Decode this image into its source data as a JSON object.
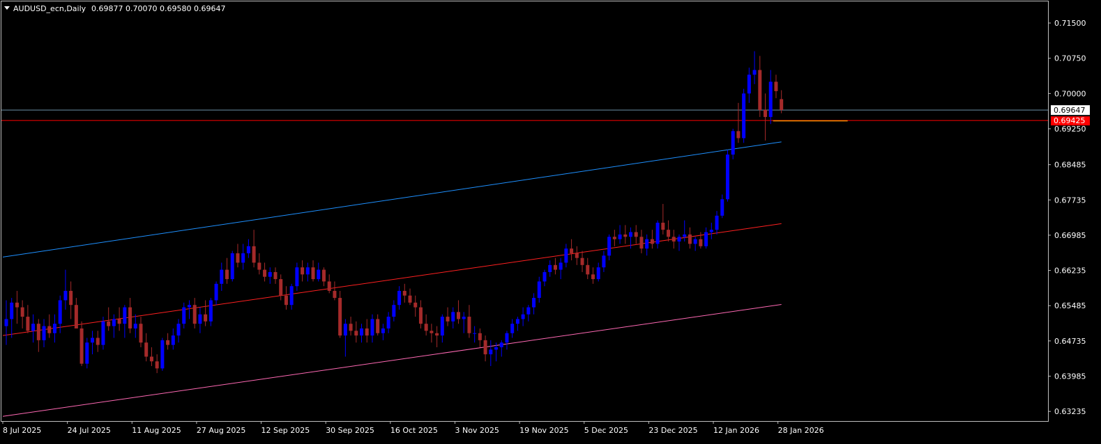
{
  "header": {
    "symbol_label": "AUDUSD_ecn,Daily",
    "ohlc": "0.69877 0.70070 0.69580 0.69647"
  },
  "colors": {
    "background": "#000000",
    "frame": "#c0c0c0",
    "bull": "#0000ff",
    "bear": "#a52a2a",
    "channel_upper": "#1e90ff",
    "channel_middle": "#ff2020",
    "channel_lower": "#ff69b4",
    "horizontal_level": "#ff0000",
    "bid_line": "#6b8fa8",
    "price_tag_bg": "#ff0000",
    "price_tag_text": "#ffffff",
    "bid_tag_bg": "#ffffff",
    "bid_tag_text": "#000000",
    "orange_segment": "#ff8c00"
  },
  "chart_data": {
    "type": "candlestick",
    "symbol": "AUDUSD_ecn",
    "timeframe": "Daily",
    "y_ticks": [
      "0.71500",
      "0.70750",
      "0.70000",
      "0.69250",
      "0.68485",
      "0.67735",
      "0.66985",
      "0.66235",
      "0.65485",
      "0.64735",
      "0.63985",
      "0.63235"
    ],
    "x_ticks": [
      "8 Jul 2025",
      "24 Jul 2025",
      "11 Aug 2025",
      "27 Aug 2025",
      "12 Sep 2025",
      "30 Sep 2025",
      "16 Oct 2025",
      "3 Nov 2025",
      "19 Nov 2025",
      "5 Dec 2025",
      "23 Dec 2025",
      "12 Jan 2026",
      "28 Jan 2026"
    ],
    "ylim": [
      0.6303,
      0.7196
    ],
    "current_bid": "0.69647",
    "horizontal_level": "0.69425",
    "channel": {
      "upper": {
        "start": 0.6652,
        "end": 0.6897
      },
      "middle": {
        "start": 0.6485,
        "end": 0.6723
      },
      "lower": {
        "start": 0.6313,
        "end": 0.6551
      }
    },
    "candles": [
      {
        "o": 0.6505,
        "h": 0.656,
        "l": 0.6465,
        "c": 0.652
      },
      {
        "o": 0.652,
        "h": 0.6565,
        "l": 0.648,
        "c": 0.6555
      },
      {
        "o": 0.6555,
        "h": 0.658,
        "l": 0.651,
        "c": 0.6545
      },
      {
        "o": 0.6545,
        "h": 0.656,
        "l": 0.65,
        "c": 0.6525
      },
      {
        "o": 0.6525,
        "h": 0.655,
        "l": 0.649,
        "c": 0.6495
      },
      {
        "o": 0.6495,
        "h": 0.653,
        "l": 0.647,
        "c": 0.651
      },
      {
        "o": 0.651,
        "h": 0.652,
        "l": 0.645,
        "c": 0.6475
      },
      {
        "o": 0.6475,
        "h": 0.652,
        "l": 0.646,
        "c": 0.6505
      },
      {
        "o": 0.6505,
        "h": 0.653,
        "l": 0.648,
        "c": 0.649
      },
      {
        "o": 0.649,
        "h": 0.653,
        "l": 0.647,
        "c": 0.651
      },
      {
        "o": 0.651,
        "h": 0.657,
        "l": 0.649,
        "c": 0.656
      },
      {
        "o": 0.656,
        "h": 0.6625,
        "l": 0.654,
        "c": 0.658
      },
      {
        "o": 0.658,
        "h": 0.66,
        "l": 0.652,
        "c": 0.655
      },
      {
        "o": 0.655,
        "h": 0.6565,
        "l": 0.65,
        "c": 0.65
      },
      {
        "o": 0.65,
        "h": 0.6515,
        "l": 0.642,
        "c": 0.6425
      },
      {
        "o": 0.6425,
        "h": 0.648,
        "l": 0.6415,
        "c": 0.647
      },
      {
        "o": 0.647,
        "h": 0.6495,
        "l": 0.6445,
        "c": 0.648
      },
      {
        "o": 0.648,
        "h": 0.6495,
        "l": 0.645,
        "c": 0.6465
      },
      {
        "o": 0.6465,
        "h": 0.6525,
        "l": 0.6455,
        "c": 0.6515
      },
      {
        "o": 0.6515,
        "h": 0.6545,
        "l": 0.6495,
        "c": 0.6505
      },
      {
        "o": 0.6505,
        "h": 0.653,
        "l": 0.648,
        "c": 0.652
      },
      {
        "o": 0.652,
        "h": 0.6545,
        "l": 0.6495,
        "c": 0.651
      },
      {
        "o": 0.651,
        "h": 0.655,
        "l": 0.648,
        "c": 0.6545
      },
      {
        "o": 0.6545,
        "h": 0.6565,
        "l": 0.649,
        "c": 0.65
      },
      {
        "o": 0.65,
        "h": 0.653,
        "l": 0.648,
        "c": 0.651
      },
      {
        "o": 0.651,
        "h": 0.6525,
        "l": 0.646,
        "c": 0.647
      },
      {
        "o": 0.647,
        "h": 0.649,
        "l": 0.643,
        "c": 0.644
      },
      {
        "o": 0.644,
        "h": 0.646,
        "l": 0.642,
        "c": 0.643
      },
      {
        "o": 0.643,
        "h": 0.6445,
        "l": 0.6405,
        "c": 0.6415
      },
      {
        "o": 0.6415,
        "h": 0.648,
        "l": 0.641,
        "c": 0.6475
      },
      {
        "o": 0.6475,
        "h": 0.649,
        "l": 0.6455,
        "c": 0.6465
      },
      {
        "o": 0.6465,
        "h": 0.65,
        "l": 0.6455,
        "c": 0.6485
      },
      {
        "o": 0.6485,
        "h": 0.652,
        "l": 0.647,
        "c": 0.651
      },
      {
        "o": 0.651,
        "h": 0.6555,
        "l": 0.65,
        "c": 0.6545
      },
      {
        "o": 0.6545,
        "h": 0.656,
        "l": 0.652,
        "c": 0.655
      },
      {
        "o": 0.655,
        "h": 0.6565,
        "l": 0.65,
        "c": 0.651
      },
      {
        "o": 0.651,
        "h": 0.6545,
        "l": 0.649,
        "c": 0.653
      },
      {
        "o": 0.653,
        "h": 0.656,
        "l": 0.6505,
        "c": 0.6515
      },
      {
        "o": 0.6515,
        "h": 0.6565,
        "l": 0.6505,
        "c": 0.656
      },
      {
        "o": 0.656,
        "h": 0.66,
        "l": 0.655,
        "c": 0.6595
      },
      {
        "o": 0.6595,
        "h": 0.664,
        "l": 0.658,
        "c": 0.6625
      },
      {
        "o": 0.6625,
        "h": 0.665,
        "l": 0.6595,
        "c": 0.6605
      },
      {
        "o": 0.6605,
        "h": 0.6665,
        "l": 0.66,
        "c": 0.666
      },
      {
        "o": 0.666,
        "h": 0.668,
        "l": 0.663,
        "c": 0.664
      },
      {
        "o": 0.664,
        "h": 0.668,
        "l": 0.6625,
        "c": 0.666
      },
      {
        "o": 0.666,
        "h": 0.669,
        "l": 0.665,
        "c": 0.6675
      },
      {
        "o": 0.6675,
        "h": 0.671,
        "l": 0.663,
        "c": 0.664
      },
      {
        "o": 0.664,
        "h": 0.666,
        "l": 0.6615,
        "c": 0.6625
      },
      {
        "o": 0.6625,
        "h": 0.664,
        "l": 0.66,
        "c": 0.661
      },
      {
        "o": 0.661,
        "h": 0.663,
        "l": 0.6595,
        "c": 0.662
      },
      {
        "o": 0.662,
        "h": 0.663,
        "l": 0.6595,
        "c": 0.6605
      },
      {
        "o": 0.6605,
        "h": 0.6615,
        "l": 0.656,
        "c": 0.657
      },
      {
        "o": 0.657,
        "h": 0.659,
        "l": 0.654,
        "c": 0.655
      },
      {
        "o": 0.655,
        "h": 0.6595,
        "l": 0.654,
        "c": 0.659
      },
      {
        "o": 0.659,
        "h": 0.664,
        "l": 0.658,
        "c": 0.663
      },
      {
        "o": 0.663,
        "h": 0.6645,
        "l": 0.66,
        "c": 0.6615
      },
      {
        "o": 0.6615,
        "h": 0.664,
        "l": 0.66,
        "c": 0.663
      },
      {
        "o": 0.663,
        "h": 0.6645,
        "l": 0.66,
        "c": 0.6605
      },
      {
        "o": 0.6605,
        "h": 0.664,
        "l": 0.66,
        "c": 0.6625
      },
      {
        "o": 0.6625,
        "h": 0.663,
        "l": 0.659,
        "c": 0.66
      },
      {
        "o": 0.66,
        "h": 0.6615,
        "l": 0.6575,
        "c": 0.658
      },
      {
        "o": 0.658,
        "h": 0.66,
        "l": 0.656,
        "c": 0.6565
      },
      {
        "o": 0.6565,
        "h": 0.658,
        "l": 0.648,
        "c": 0.6485
      },
      {
        "o": 0.6485,
        "h": 0.652,
        "l": 0.644,
        "c": 0.651
      },
      {
        "o": 0.651,
        "h": 0.6525,
        "l": 0.6485,
        "c": 0.6495
      },
      {
        "o": 0.6495,
        "h": 0.6515,
        "l": 0.647,
        "c": 0.6485
      },
      {
        "o": 0.6485,
        "h": 0.651,
        "l": 0.647,
        "c": 0.65
      },
      {
        "o": 0.65,
        "h": 0.652,
        "l": 0.647,
        "c": 0.6485
      },
      {
        "o": 0.6485,
        "h": 0.653,
        "l": 0.647,
        "c": 0.652
      },
      {
        "o": 0.652,
        "h": 0.653,
        "l": 0.6485,
        "c": 0.649
      },
      {
        "o": 0.649,
        "h": 0.651,
        "l": 0.6475,
        "c": 0.65
      },
      {
        "o": 0.65,
        "h": 0.6535,
        "l": 0.649,
        "c": 0.6525
      },
      {
        "o": 0.6525,
        "h": 0.656,
        "l": 0.6515,
        "c": 0.655
      },
      {
        "o": 0.655,
        "h": 0.659,
        "l": 0.654,
        "c": 0.658
      },
      {
        "o": 0.658,
        "h": 0.6595,
        "l": 0.6555,
        "c": 0.657
      },
      {
        "o": 0.657,
        "h": 0.6585,
        "l": 0.655,
        "c": 0.6555
      },
      {
        "o": 0.6555,
        "h": 0.657,
        "l": 0.6525,
        "c": 0.6545
      },
      {
        "o": 0.6545,
        "h": 0.656,
        "l": 0.65,
        "c": 0.651
      },
      {
        "o": 0.651,
        "h": 0.653,
        "l": 0.6485,
        "c": 0.6495
      },
      {
        "o": 0.6495,
        "h": 0.651,
        "l": 0.647,
        "c": 0.649
      },
      {
        "o": 0.649,
        "h": 0.6505,
        "l": 0.646,
        "c": 0.6485
      },
      {
        "o": 0.6485,
        "h": 0.653,
        "l": 0.647,
        "c": 0.6525
      },
      {
        "o": 0.6525,
        "h": 0.6545,
        "l": 0.6505,
        "c": 0.6515
      },
      {
        "o": 0.6515,
        "h": 0.6545,
        "l": 0.65,
        "c": 0.6535
      },
      {
        "o": 0.6535,
        "h": 0.656,
        "l": 0.651,
        "c": 0.652
      },
      {
        "o": 0.652,
        "h": 0.6535,
        "l": 0.649,
        "c": 0.6525
      },
      {
        "o": 0.6525,
        "h": 0.655,
        "l": 0.648,
        "c": 0.649
      },
      {
        "o": 0.649,
        "h": 0.6505,
        "l": 0.647,
        "c": 0.649
      },
      {
        "o": 0.649,
        "h": 0.65,
        "l": 0.646,
        "c": 0.6475
      },
      {
        "o": 0.6475,
        "h": 0.6485,
        "l": 0.643,
        "c": 0.6445
      },
      {
        "o": 0.6445,
        "h": 0.6475,
        "l": 0.642,
        "c": 0.6455
      },
      {
        "o": 0.6455,
        "h": 0.647,
        "l": 0.643,
        "c": 0.646
      },
      {
        "o": 0.646,
        "h": 0.6475,
        "l": 0.644,
        "c": 0.647
      },
      {
        "o": 0.647,
        "h": 0.6495,
        "l": 0.6455,
        "c": 0.649
      },
      {
        "o": 0.649,
        "h": 0.652,
        "l": 0.648,
        "c": 0.651
      },
      {
        "o": 0.651,
        "h": 0.6525,
        "l": 0.6495,
        "c": 0.652
      },
      {
        "o": 0.652,
        "h": 0.6545,
        "l": 0.6505,
        "c": 0.653
      },
      {
        "o": 0.653,
        "h": 0.655,
        "l": 0.6515,
        "c": 0.6545
      },
      {
        "o": 0.6545,
        "h": 0.6575,
        "l": 0.653,
        "c": 0.6565
      },
      {
        "o": 0.6565,
        "h": 0.661,
        "l": 0.6555,
        "c": 0.66
      },
      {
        "o": 0.66,
        "h": 0.6625,
        "l": 0.659,
        "c": 0.662
      },
      {
        "o": 0.662,
        "h": 0.6645,
        "l": 0.661,
        "c": 0.6635
      },
      {
        "o": 0.6635,
        "h": 0.665,
        "l": 0.6615,
        "c": 0.6625
      },
      {
        "o": 0.6625,
        "h": 0.665,
        "l": 0.6605,
        "c": 0.664
      },
      {
        "o": 0.664,
        "h": 0.668,
        "l": 0.663,
        "c": 0.667
      },
      {
        "o": 0.667,
        "h": 0.669,
        "l": 0.6645,
        "c": 0.666
      },
      {
        "o": 0.666,
        "h": 0.6675,
        "l": 0.6635,
        "c": 0.665
      },
      {
        "o": 0.665,
        "h": 0.6665,
        "l": 0.662,
        "c": 0.6635
      },
      {
        "o": 0.6635,
        "h": 0.665,
        "l": 0.6605,
        "c": 0.6615
      },
      {
        "o": 0.6615,
        "h": 0.663,
        "l": 0.6595,
        "c": 0.6605
      },
      {
        "o": 0.6605,
        "h": 0.664,
        "l": 0.66,
        "c": 0.663
      },
      {
        "o": 0.663,
        "h": 0.6665,
        "l": 0.662,
        "c": 0.6655
      },
      {
        "o": 0.6655,
        "h": 0.67,
        "l": 0.6645,
        "c": 0.6695
      },
      {
        "o": 0.6695,
        "h": 0.671,
        "l": 0.6675,
        "c": 0.669
      },
      {
        "o": 0.669,
        "h": 0.672,
        "l": 0.668,
        "c": 0.67
      },
      {
        "o": 0.67,
        "h": 0.672,
        "l": 0.668,
        "c": 0.6695
      },
      {
        "o": 0.6695,
        "h": 0.6715,
        "l": 0.667,
        "c": 0.6705
      },
      {
        "o": 0.6705,
        "h": 0.672,
        "l": 0.668,
        "c": 0.6695
      },
      {
        "o": 0.6695,
        "h": 0.671,
        "l": 0.666,
        "c": 0.667
      },
      {
        "o": 0.667,
        "h": 0.67,
        "l": 0.6655,
        "c": 0.669
      },
      {
        "o": 0.669,
        "h": 0.671,
        "l": 0.667,
        "c": 0.668
      },
      {
        "o": 0.668,
        "h": 0.673,
        "l": 0.667,
        "c": 0.6725
      },
      {
        "o": 0.6725,
        "h": 0.6765,
        "l": 0.67,
        "c": 0.671
      },
      {
        "o": 0.671,
        "h": 0.673,
        "l": 0.6685,
        "c": 0.6695
      },
      {
        "o": 0.6695,
        "h": 0.671,
        "l": 0.667,
        "c": 0.6685
      },
      {
        "o": 0.6685,
        "h": 0.67,
        "l": 0.6665,
        "c": 0.6695
      },
      {
        "o": 0.6695,
        "h": 0.673,
        "l": 0.6685,
        "c": 0.67
      },
      {
        "o": 0.67,
        "h": 0.6715,
        "l": 0.667,
        "c": 0.668
      },
      {
        "o": 0.668,
        "h": 0.6695,
        "l": 0.6665,
        "c": 0.669
      },
      {
        "o": 0.669,
        "h": 0.6705,
        "l": 0.667,
        "c": 0.6675
      },
      {
        "o": 0.6675,
        "h": 0.6715,
        "l": 0.667,
        "c": 0.6705
      },
      {
        "o": 0.6705,
        "h": 0.6725,
        "l": 0.669,
        "c": 0.671
      },
      {
        "o": 0.671,
        "h": 0.675,
        "l": 0.67,
        "c": 0.674
      },
      {
        "o": 0.674,
        "h": 0.6785,
        "l": 0.6735,
        "c": 0.6775
      },
      {
        "o": 0.6775,
        "h": 0.688,
        "l": 0.677,
        "c": 0.687
      },
      {
        "o": 0.687,
        "h": 0.6925,
        "l": 0.686,
        "c": 0.692
      },
      {
        "o": 0.692,
        "h": 0.698,
        "l": 0.6895,
        "c": 0.6905
      },
      {
        "o": 0.6905,
        "h": 0.701,
        "l": 0.6895,
        "c": 0.7
      },
      {
        "o": 0.7,
        "h": 0.7055,
        "l": 0.698,
        "c": 0.704
      },
      {
        "o": 0.704,
        "h": 0.709,
        "l": 0.702,
        "c": 0.705
      },
      {
        "o": 0.705,
        "h": 0.708,
        "l": 0.695,
        "c": 0.6965
      },
      {
        "o": 0.6965,
        "h": 0.7,
        "l": 0.69,
        "c": 0.695
      },
      {
        "o": 0.695,
        "h": 0.705,
        "l": 0.6935,
        "c": 0.7025
      },
      {
        "o": 0.7025,
        "h": 0.704,
        "l": 0.699,
        "c": 0.7005
      },
      {
        "o": 0.6988,
        "h": 0.7007,
        "l": 0.6958,
        "c": 0.6965
      }
    ]
  }
}
